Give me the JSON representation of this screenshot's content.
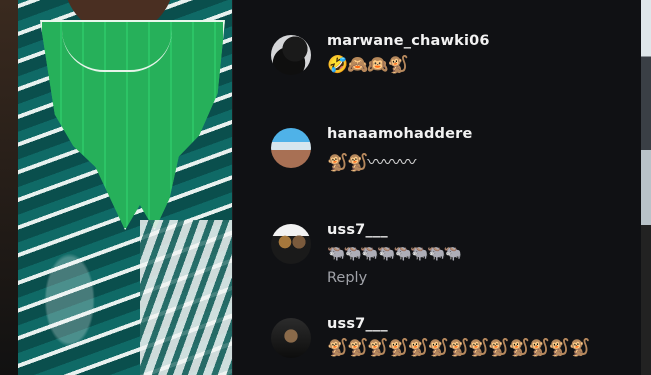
{
  "comments": [
    {
      "username": "marwane_chawki06",
      "message": "🤣🙈🙉🐒"
    },
    {
      "username": "hanaamohaddere",
      "message": "🐒🐒〰〰〰"
    },
    {
      "username": "uss7___",
      "message": "🐃🐃🐃🐃🐃🐃🐃🐃",
      "reply_label": "Reply"
    },
    {
      "username": "uss7___",
      "message": "🐒🐒🐒🐒🐒🐒🐒🐒🐒🐒🐒🐒🐒"
    }
  ]
}
